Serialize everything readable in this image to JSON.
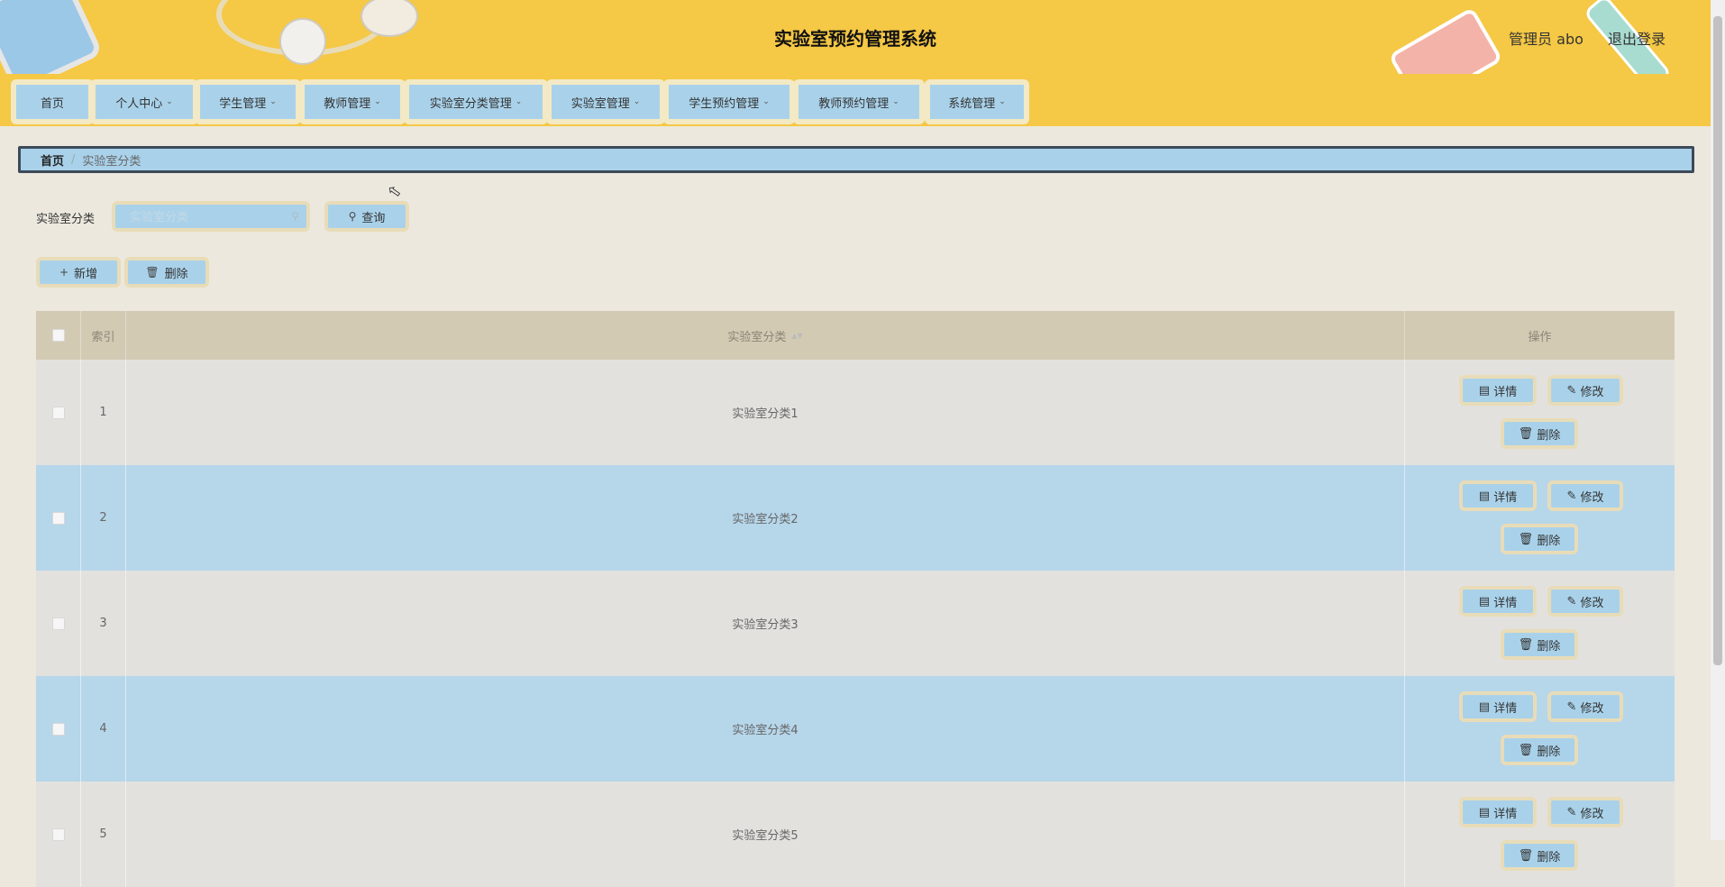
{
  "header": {
    "title": "实验室预约管理系统",
    "user": "管理员 abo",
    "logout": "退出登录"
  },
  "nav": [
    {
      "label": "首页",
      "has_dropdown": false
    },
    {
      "label": "个人中心",
      "has_dropdown": true
    },
    {
      "label": "学生管理",
      "has_dropdown": true
    },
    {
      "label": "教师管理",
      "has_dropdown": true
    },
    {
      "label": "实验室分类管理",
      "has_dropdown": true
    },
    {
      "label": "实验室管理",
      "has_dropdown": true
    },
    {
      "label": "学生预约管理",
      "has_dropdown": true
    },
    {
      "label": "教师预约管理",
      "has_dropdown": true
    },
    {
      "label": "系统管理",
      "has_dropdown": true
    }
  ],
  "breadcrumb": {
    "home": "首页",
    "current": "实验室分类"
  },
  "search": {
    "label": "实验室分类",
    "placeholder": "实验室分类",
    "value": "",
    "button": "查询"
  },
  "actions": {
    "add": "新增",
    "delete": "删除"
  },
  "table": {
    "columns": {
      "index": "索引",
      "name": "实验室分类",
      "ops": "操作"
    },
    "row_buttons": {
      "detail": "详情",
      "edit": "修改",
      "delete": "删除"
    },
    "rows": [
      {
        "index": "1",
        "name": "实验室分类1"
      },
      {
        "index": "2",
        "name": "实验室分类2"
      },
      {
        "index": "3",
        "name": "实验室分类3"
      },
      {
        "index": "4",
        "name": "实验室分类4"
      },
      {
        "index": "5",
        "name": "实验室分类5"
      }
    ]
  },
  "colors": {
    "header_bg": "#f5c845",
    "button_bg": "#a9d2ea",
    "button_border": "#e8dcb8",
    "page_bg": "#ece8de"
  }
}
